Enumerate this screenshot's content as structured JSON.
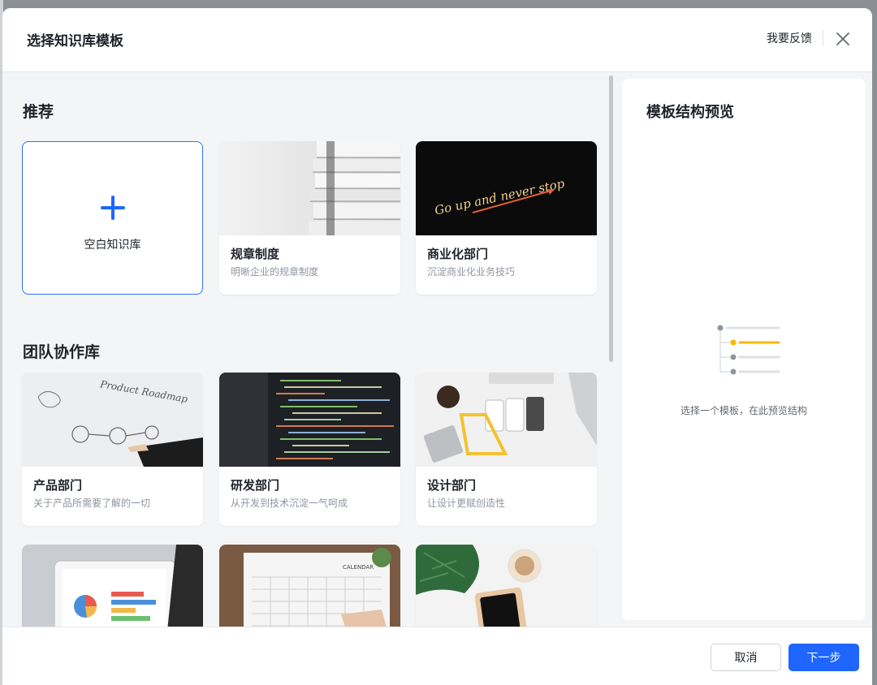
{
  "dialog": {
    "title": "选择知识库模板",
    "feedback_label": "我要反馈",
    "close_icon": "close-icon"
  },
  "sections": {
    "recommended": {
      "title": "推荐",
      "blank_label": "空白知识库",
      "cards": [
        {
          "name": "规章制度",
          "desc": "明晰企业的规章制度",
          "thumb": "stack-of-documents"
        },
        {
          "name": "商业化部门",
          "desc": "沉淀商业化业务技巧",
          "thumb": "neon-go-up-and-never-stop"
        }
      ]
    },
    "team": {
      "title": "团队协作库",
      "cards": [
        {
          "name": "产品部门",
          "desc": "关于产品所需要了解的一切",
          "thumb": "whiteboard-product-roadmap"
        },
        {
          "name": "研发部门",
          "desc": "从开发到技术沉淀一气呵成",
          "thumb": "code-on-screen"
        },
        {
          "name": "设计部门",
          "desc": "让设计更赋创造性",
          "thumb": "designer-desk"
        },
        {
          "name": "",
          "desc": "",
          "thumb": "tablet-with-charts"
        },
        {
          "name": "",
          "desc": "",
          "thumb": "calendar-on-desk"
        },
        {
          "name": "",
          "desc": "",
          "thumb": "plant-and-coffee"
        }
      ]
    }
  },
  "thumb_text": {
    "neon": "Go up and never stop",
    "whiteboard": "Product Roadmap",
    "calendar": "CALENDAR"
  },
  "preview": {
    "title": "模板结构预览",
    "hint": "选择一个模板，在此预览结构"
  },
  "footer": {
    "cancel_label": "取消",
    "next_label": "下一步"
  },
  "colors": {
    "primary": "#1f66ff",
    "accent_yellow": "#f5b900"
  }
}
